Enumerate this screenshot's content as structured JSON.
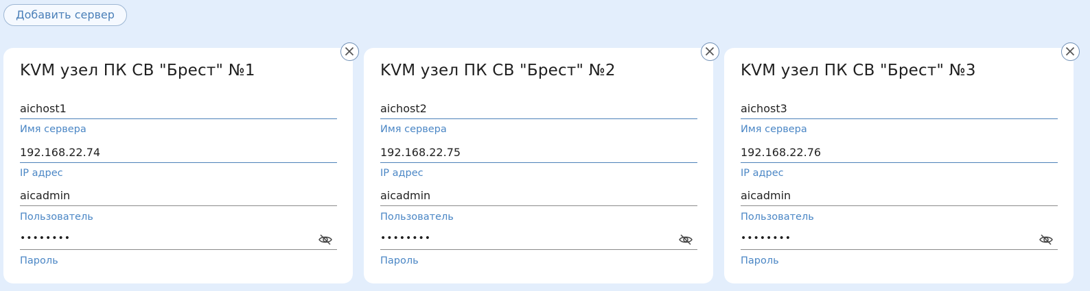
{
  "toolbar": {
    "add_server_label": "Добавить сервер"
  },
  "colors": {
    "background": "#e3eefc",
    "accent": "#4a86c5",
    "card": "#ffffff"
  },
  "labels": {
    "server_name": "Имя сервера",
    "ip_address": "IP адрес",
    "user": "Пользователь",
    "password": "Пароль"
  },
  "icons": {
    "close": "close-icon",
    "password_toggle": "eye-slash-icon"
  },
  "servers": [
    {
      "title": "KVM узел ПК СВ \"Брест\" №1",
      "server_name": "aichost1",
      "ip": "192.168.22.74",
      "user": "aicadmin",
      "password_mask": "••••••••"
    },
    {
      "title": "KVM узел ПК СВ \"Брест\" №2",
      "server_name": "aichost2",
      "ip": "192.168.22.75",
      "user": "aicadmin",
      "password_mask": "••••••••"
    },
    {
      "title": "KVM узел ПК СВ \"Брест\" №3",
      "server_name": "aichost3",
      "ip": "192.168.22.76",
      "user": "aicadmin",
      "password_mask": "••••••••"
    }
  ]
}
